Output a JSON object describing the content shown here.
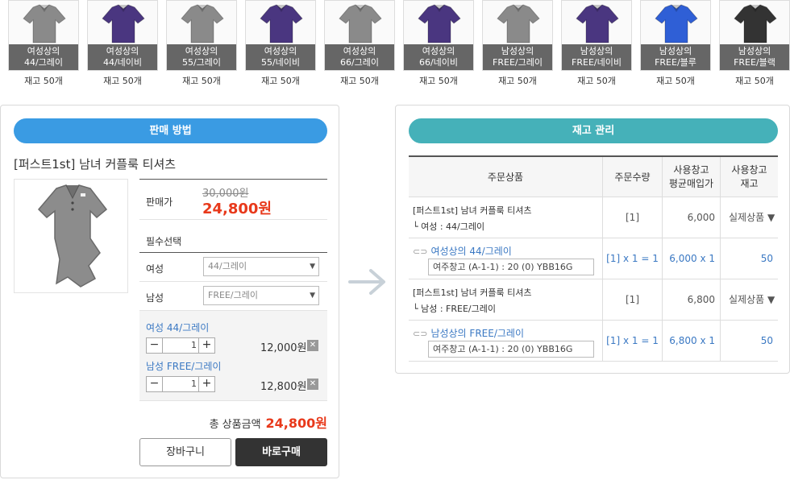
{
  "thumbnails": [
    {
      "line1": "여성상의",
      "line2": "44/그레이",
      "stock": "재고 50개",
      "color": "#8a8a8a"
    },
    {
      "line1": "여성상의",
      "line2": "44/네이비",
      "stock": "재고 50개",
      "color": "#4a3680"
    },
    {
      "line1": "여성상의",
      "line2": "55/그레이",
      "stock": "재고 50개",
      "color": "#8a8a8a"
    },
    {
      "line1": "여성상의",
      "line2": "55/네이비",
      "stock": "재고 50개",
      "color": "#4a3680"
    },
    {
      "line1": "여성상의",
      "line2": "66/그레이",
      "stock": "재고 50개",
      "color": "#8a8a8a"
    },
    {
      "line1": "여성상의",
      "line2": "66/네이비",
      "stock": "재고 50개",
      "color": "#4a3680"
    },
    {
      "line1": "남성상의",
      "line2": "FREE/그레이",
      "stock": "재고 50개",
      "color": "#8a8a8a"
    },
    {
      "line1": "남성상의",
      "line2": "FREE/네이비",
      "stock": "재고 50개",
      "color": "#4a3680"
    },
    {
      "line1": "남성상의",
      "line2": "FREE/블루",
      "stock": "재고 50개",
      "color": "#2f5fd6"
    },
    {
      "line1": "남성상의",
      "line2": "FREE/블랙",
      "stock": "재고 50개",
      "color": "#333333"
    }
  ],
  "sales": {
    "header": "판매 방법",
    "product_title": "[퍼스트1st] 남녀 커플룩 티셔츠",
    "price_label": "판매가",
    "original_price": "30,000원",
    "sale_price": "24,800원",
    "required_label": "필수선택",
    "options": [
      {
        "label": "여성",
        "value": "44/그레이"
      },
      {
        "label": "남성",
        "value": "FREE/그레이"
      }
    ],
    "chosen": [
      {
        "name": "여성 44/그레이",
        "qty": "1",
        "price": "12,000원"
      },
      {
        "name": "남성 FREE/그레이",
        "qty": "1",
        "price": "12,800원"
      }
    ],
    "total_label": "총 상품금액",
    "total_value": "24,800원",
    "cart_button": "장바구니",
    "buy_button": "바로구매"
  },
  "inventory": {
    "header": "재고 관리",
    "columns": {
      "product": "주문상품",
      "qty": "주문수량",
      "avg_cost_l1": "사용창고",
      "avg_cost_l2": "평균매입가",
      "stock_l1": "사용창고",
      "stock_l2": "재고"
    },
    "rows": [
      {
        "name": "[퍼스트1st] 남녀 커플룩 티셔츠",
        "sub": "└ 여성 : 44/그레이",
        "qty": "[1]",
        "cost": "6,000",
        "stock": "실제상품 ▼"
      },
      {
        "link": "여성상의 44/그레이",
        "warehouse": "여주창고 (A-1-1) : 20 (0) YBB16G",
        "qty": "[1] x 1 = 1",
        "cost": "6,000 x 1",
        "stock": "50"
      },
      {
        "name": "[퍼스트1st] 남녀 커플룩 티셔츠",
        "sub": "└ 남성 : FREE/그레이",
        "qty": "[1]",
        "cost": "6,800",
        "stock": "실제상품 ▼"
      },
      {
        "link": "남성상의 FREE/그레이",
        "warehouse": "여주창고 (A-1-1) : 20 (0) YBB16G",
        "qty": "[1] x 1 = 1",
        "cost": "6,800 x 1",
        "stock": "50"
      }
    ]
  }
}
